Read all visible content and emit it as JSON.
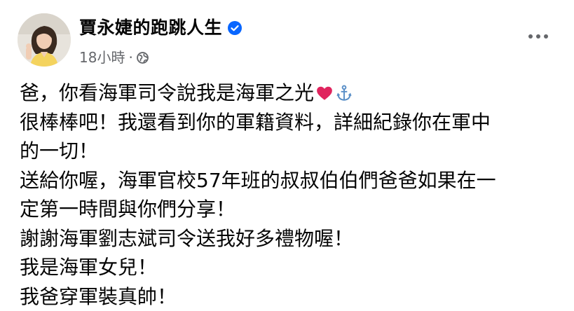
{
  "post": {
    "author": {
      "name": "賈永婕的跑跳人生",
      "verified": true
    },
    "meta": {
      "time": "18小時",
      "separator": "·",
      "audience_icon": "globe-icon"
    },
    "more_icon": "more-horizontal-icon",
    "lines": [
      "爸，你看海軍司令說我是海軍之光",
      "很棒棒吧！我還看到你的軍籍資料，詳細紀錄你在軍中",
      "的一切！",
      "送給你喔，海軍官校57年班的叔叔伯伯們爸爸如果在一",
      "定第一時間與你們分享！",
      "謝謝海軍劉志斌司令送我好多禮物喔！",
      "我是海軍女兒！",
      "我爸穿軍裝真帥！"
    ],
    "first_line_emojis": [
      "red-heart-icon",
      "anchor-icon"
    ]
  },
  "colors": {
    "text_primary": "#050505",
    "text_secondary": "#65676b",
    "verified_blue": "#0866ff",
    "heart_red": "#e0245e",
    "anchor_blue": "#5a8fc7"
  }
}
